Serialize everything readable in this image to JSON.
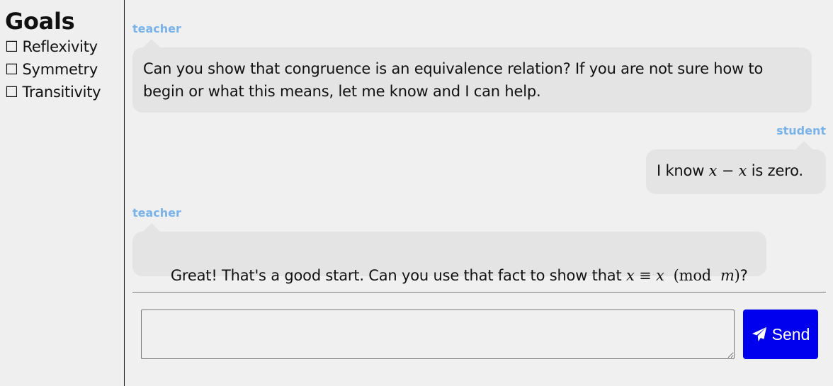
{
  "sidebar": {
    "title": "Goals",
    "goals": [
      {
        "label": "Reflexivity",
        "checked": false,
        "checkbox_glyph": "☐"
      },
      {
        "label": "Symmetry",
        "checked": false,
        "checkbox_glyph": "☐"
      },
      {
        "label": "Transitivity",
        "checked": false,
        "checkbox_glyph": "☐"
      }
    ]
  },
  "chat": {
    "messages": [
      {
        "sender": "teacher",
        "text": "Can you show that congruence is an equivalence relation? If you are not sure how to begin or what this means, let me know and I can help."
      },
      {
        "sender": "student",
        "text_before": "I know ",
        "math_x1": "x",
        "math_op": " − ",
        "math_x2": "x",
        "text_after": " is zero."
      },
      {
        "sender": "teacher",
        "text_before": "Great! That's a good start. Can you use that fact to show that ",
        "math_x1": "x",
        "math_op": " ≡ ",
        "math_x2": "x",
        "math_mod_open": "  (mod  ",
        "math_m": "m",
        "math_mod_close": ")",
        "text_after": "?"
      }
    ]
  },
  "composer": {
    "input_value": "",
    "input_placeholder": "",
    "send_label": "Send",
    "send_icon": "paper-plane-icon",
    "send_color": "#0000ee"
  },
  "colors": {
    "sender_label": "#7ab3ea",
    "bubble_bg": "#e4e4e4",
    "page_bg": "#f0f0f0"
  }
}
